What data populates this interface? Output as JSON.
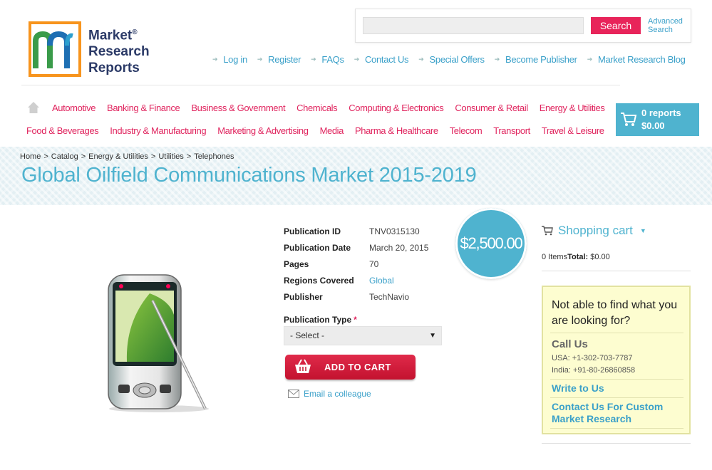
{
  "brand": {
    "name_line1": "Market",
    "name_line2": "Research",
    "name_line3": "Reports",
    "registered": "®"
  },
  "search": {
    "placeholder": "",
    "button": "Search",
    "advanced_line1": "Advanced",
    "advanced_line2": "Search"
  },
  "top_links": [
    "Log in",
    "Register",
    "FAQs",
    "Contact Us",
    "Special Offers",
    "Become Publisher",
    "Market Research Blog"
  ],
  "categories_row1": [
    "Automotive",
    "Banking & Finance",
    "Business & Government",
    "Chemicals",
    "Computing & Electronics",
    "Consumer & Retail",
    "Energy & Utilities"
  ],
  "categories_row2": [
    "Food & Beverages",
    "Industry & Manufacturing",
    "Marketing & Advertising",
    "Media",
    "Pharma & Healthcare",
    "Telecom",
    "Transport",
    "Travel & Leisure"
  ],
  "header_cart": {
    "reports": "0 reports",
    "total": "$0.00"
  },
  "breadcrumb": [
    "Home",
    "Catalog",
    "Energy & Utilities",
    "Utilities",
    "Telephones"
  ],
  "page_title": "Global Oilfield Communications Market 2015-2019",
  "product": {
    "details": [
      {
        "label": "Publication ID",
        "value": "TNV0315130"
      },
      {
        "label": "Publication Date",
        "value": "March 20, 2015"
      },
      {
        "label": "Pages",
        "value": "70"
      },
      {
        "label": "Regions Covered",
        "value": "Global"
      },
      {
        "label": "Publisher",
        "value": "TechNavio"
      }
    ],
    "price": "$2,500.00",
    "publication_type_label": "Publication Type",
    "required_mark": "*",
    "publication_type_selected": "- Select -",
    "add_to_cart": "ADD TO CART",
    "email_colleague": "Email a colleague"
  },
  "sidebar": {
    "cart_title": "Shopping cart",
    "items_text": "0 Items",
    "total_label": "Total:",
    "total_value": "$0.00",
    "help_title": "Not able to find what you are looking for?",
    "call_us": "Call Us",
    "phone_usa": "USA: +1-302-703-7787",
    "phone_india": "India: +91-80-26860858",
    "write_to_us": "Write to Us",
    "custom_research_line1": "Contact Us For Custom",
    "custom_research_line2": "Market Research"
  },
  "colors": {
    "accent_pink": "#e0245e",
    "accent_blue": "#4fb3cf",
    "link_blue": "#3aa0c9",
    "logo_orange": "#f7941d"
  }
}
